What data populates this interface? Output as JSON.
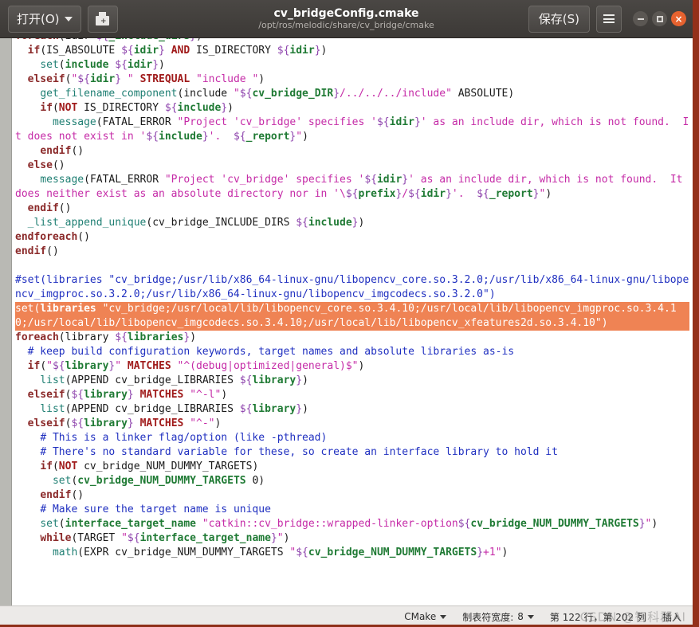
{
  "titlebar": {
    "open_label": "打开(O)",
    "saveas_icon": "save-as-disk-icon",
    "doc_title": "cv_bridgeConfig.cmake",
    "doc_path": "/opt/ros/melodic/share/cv_bridge/cmake",
    "save_label": "保存(S)",
    "menu_icon": "hamburger-menu-icon",
    "minimize_icon": "minimize-icon",
    "maximize_icon": "maximize-icon",
    "close_icon": "close-icon",
    "close_glyph": "×",
    "accent_close_color": "#e6622f",
    "bar_color": "#3c3936"
  },
  "statusbar": {
    "language": "CMake",
    "tab_width_label": "制表符宽度:",
    "tab_width_value": "8",
    "position": "第 122 行，第 202 列",
    "insert_mode": "插入",
    "watermark": "CSDN @智科郡AI"
  },
  "editor": {
    "selection_color": "#ef8354",
    "background": "#ffffff",
    "gutter_color": "#b9b9b4",
    "font_size_px": 13
  },
  "code_lines": [
    {
      "id": "l1",
      "clipped": true,
      "text": "foreach(idir ${_include_dirs})"
    },
    {
      "id": "l2",
      "text": "  if(IS_ABSOLUTE ${idir} AND IS_DIRECTORY ${idir})"
    },
    {
      "id": "l3",
      "text": "    set(include ${idir})"
    },
    {
      "id": "l4",
      "text": "  elseif(\"${idir} \" STREQUAL \"include \")"
    },
    {
      "id": "l5",
      "text": "    get_filename_component(include \"${cv_bridge_DIR}/../../../include\" ABSOLUTE)"
    },
    {
      "id": "l6",
      "text": "    if(NOT IS_DIRECTORY ${include})"
    },
    {
      "id": "l7",
      "text": "      message(FATAL_ERROR \"Project 'cv_bridge' specifies '${idir}' as an include dir, which is not found.  It does not exist in '${include}'.  ${_report}\")"
    },
    {
      "id": "l8",
      "text": "    endif()"
    },
    {
      "id": "l9",
      "text": "  else()"
    },
    {
      "id": "l10",
      "text": "    message(FATAL_ERROR \"Project 'cv_bridge' specifies '${idir}' as an include dir, which is not found.  It does neither exist as an absolute directory nor in '\\${prefix}/${idir}'.  ${_report}\")"
    },
    {
      "id": "l11",
      "text": "  endif()"
    },
    {
      "id": "l12",
      "text": "  _list_append_unique(cv_bridge_INCLUDE_DIRS ${include})"
    },
    {
      "id": "l13",
      "text": "endforeach()"
    },
    {
      "id": "l14",
      "text": "endif()"
    },
    {
      "id": "l15",
      "text": ""
    },
    {
      "id": "l16",
      "text": "#set(libraries \"cv_bridge;/usr/lib/x86_64-linux-gnu/libopencv_core.so.3.2.0;/usr/lib/x86_64-linux-gnu/libopencv_imgproc.so.3.2.0;/usr/lib/x86_64-linux-gnu/libopencv_imgcodecs.so.3.2.0\")"
    },
    {
      "id": "l17",
      "selected": true,
      "text": "set(libraries \"cv_bridge;/usr/local/lib/libopencv_core.so.3.4.10;/usr/local/lib/libopencv_imgproc.so.3.4.10;/usr/local/lib/libopencv_imgcodecs.so.3.4.10;/usr/local/lib/libopencv_xfeatures2d.so.3.4.10\")"
    },
    {
      "id": "l18",
      "text": "foreach(library ${libraries})"
    },
    {
      "id": "l19",
      "text": "  # keep build configuration keywords, target names and absolute libraries as-is"
    },
    {
      "id": "l20",
      "text": "  if(\"${library}\" MATCHES \"^(debug|optimized|general)$\")"
    },
    {
      "id": "l21",
      "text": "    list(APPEND cv_bridge_LIBRARIES ${library})"
    },
    {
      "id": "l22",
      "text": "  elseif(${library} MATCHES \"^-l\")"
    },
    {
      "id": "l23",
      "text": "    list(APPEND cv_bridge_LIBRARIES ${library})"
    },
    {
      "id": "l24",
      "text": "  elseif(${library} MATCHES \"^-\")"
    },
    {
      "id": "l25",
      "text": "    # This is a linker flag/option (like -pthread)"
    },
    {
      "id": "l26",
      "text": "    # There's no standard variable for these, so create an interface library to hold it"
    },
    {
      "id": "l27",
      "text": "    if(NOT cv_bridge_NUM_DUMMY_TARGETS)"
    },
    {
      "id": "l28",
      "text": "      set(cv_bridge_NUM_DUMMY_TARGETS 0)"
    },
    {
      "id": "l29",
      "text": "    endif()"
    },
    {
      "id": "l30",
      "text": "    # Make sure the target name is unique"
    },
    {
      "id": "l31",
      "text": "    set(interface_target_name \"catkin::cv_bridge::wrapped-linker-option${cv_bridge_NUM_DUMMY_TARGETS}\")"
    },
    {
      "id": "l32",
      "text": "    while(TARGET \"${interface_target_name}\")"
    },
    {
      "id": "l33",
      "text": "      math(EXPR cv_bridge_NUM_DUMMY_TARGETS \"${cv_bridge_NUM_DUMMY_TARGETS}+1\")"
    }
  ]
}
